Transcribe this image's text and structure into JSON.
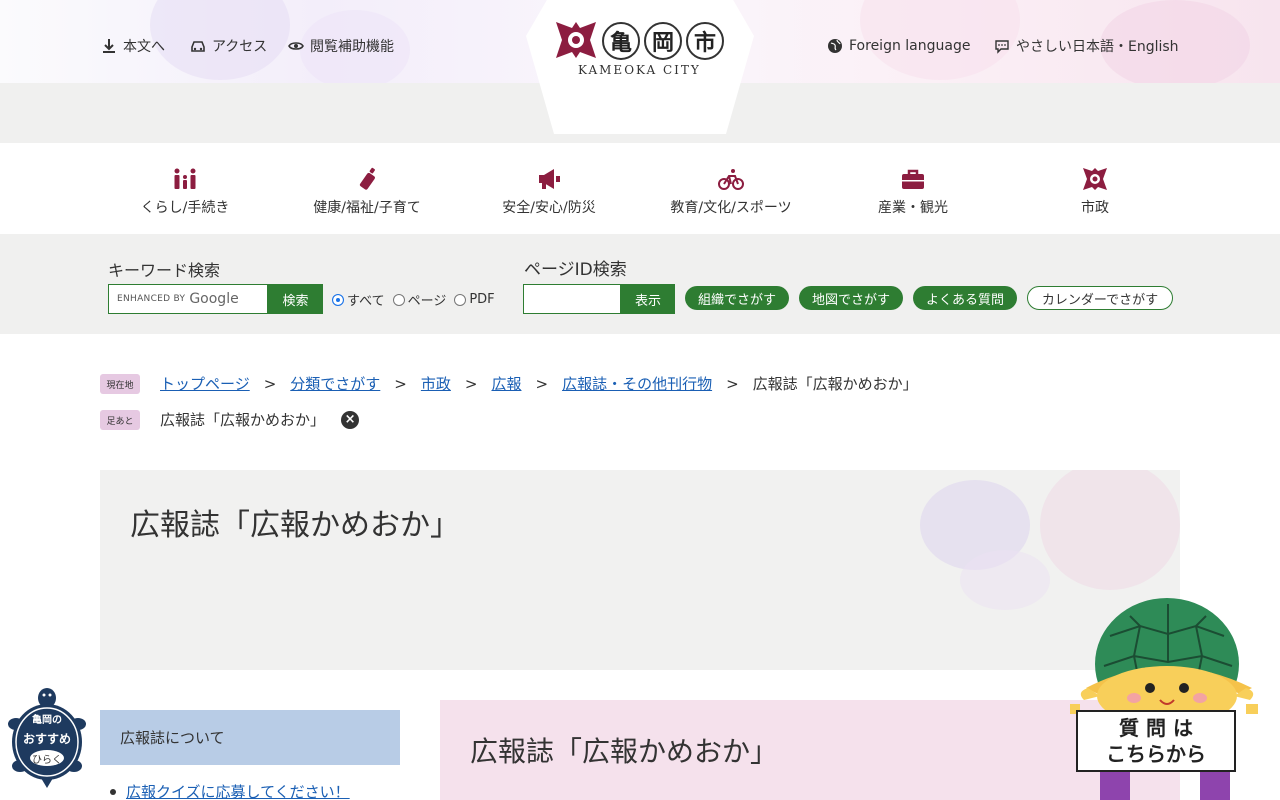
{
  "header": {
    "utility_left": [
      {
        "icon": "download-icon",
        "label": "本文へ"
      },
      {
        "icon": "car-icon",
        "label": "アクセス"
      },
      {
        "icon": "eye-icon",
        "label": "閲覧補助機能"
      }
    ],
    "utility_right": [
      {
        "icon": "globe-icon",
        "label": "Foreign language"
      },
      {
        "icon": "speech-bubble-icon",
        "label": "やさしい日本語・English"
      }
    ],
    "logo": {
      "kanji": [
        "亀",
        "岡",
        "市"
      ],
      "sub": "KAMEOKA CITY"
    }
  },
  "gnav": [
    {
      "icon": "family-icon",
      "label": "くらし/手続き"
    },
    {
      "icon": "baby-bottle-icon",
      "label": "健康/福祉/子育て"
    },
    {
      "icon": "megaphone-icon",
      "label": "安全/安心/防災"
    },
    {
      "icon": "bicycle-icon",
      "label": "教育/文化/スポーツ"
    },
    {
      "icon": "briefcase-icon",
      "label": "産業・観光"
    },
    {
      "icon": "city-emblem-icon",
      "label": "市政"
    }
  ],
  "search": {
    "keyword_label": "キーワード検索",
    "enhanced_by": "ENHANCED BY",
    "google": "Google",
    "search_button": "検索",
    "radios": [
      {
        "label": "すべて",
        "checked": true
      },
      {
        "label": "ページ",
        "checked": false
      },
      {
        "label": "PDF",
        "checked": false
      }
    ],
    "page_id_label": "ページID検索",
    "page_id_button": "表示",
    "pills": [
      {
        "label": "組織でさがす",
        "style": "solid"
      },
      {
        "label": "地図でさがす",
        "style": "solid"
      },
      {
        "label": "よくある質問",
        "style": "solid"
      },
      {
        "label": "カレンダーでさがす",
        "style": "outline"
      }
    ]
  },
  "breadcrumb": {
    "tag": "現在地",
    "links": [
      "トップページ",
      "分類でさがす",
      "市政",
      "広報",
      "広報誌・その他刊行物"
    ],
    "current": "広報誌「広報かめおか」",
    "separator": ">"
  },
  "footprint": {
    "tag": "足あと",
    "item": "広報誌「広報かめおか」"
  },
  "page_title": "広報誌「広報かめおか」",
  "side": {
    "heading": "広報誌について",
    "link": "広報クイズに応募してください！"
  },
  "main": {
    "heading": "広報誌「広報かめおか」"
  },
  "floating": {
    "turtle_line1": "亀岡の",
    "turtle_line2": "おすすめ",
    "turtle_line3": "ひらく",
    "question_line1": "質 問 は",
    "question_line2": "こちらから"
  },
  "colors": {
    "brand_green": "#2e7d32",
    "accent_maroon": "#8c1d40",
    "link_blue": "#1a5fb4",
    "side_head_blue": "#b8cce6",
    "main_head_pink": "#f5e1ec"
  }
}
